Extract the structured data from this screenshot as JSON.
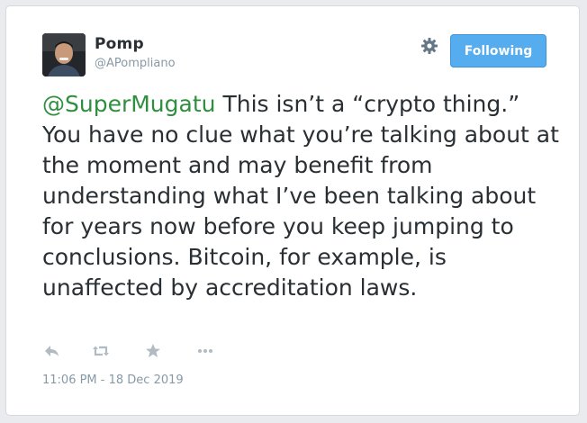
{
  "author": {
    "name": "Pomp",
    "handle": "@APompliano"
  },
  "follow_button": {
    "label": "Following"
  },
  "tweet": {
    "mention": "@SuperMugatu",
    "body": " This isn’t a “crypto thing.” You have no clue what you’re talking about at the moment and may benefit from understanding what I’ve been talking about for years now before you keep jumping to conclusions. Bitcoin, for example, is unaffected by accreditation laws."
  },
  "actions": {
    "icons": [
      "reply-icon",
      "retweet-icon",
      "like-icon",
      "more-icon"
    ]
  },
  "timestamp": "11:06 PM - 18 Dec 2019",
  "colors": {
    "accent": "#55acee",
    "mention": "#2f8f3f",
    "text": "#292f33",
    "muted": "#8899a6"
  }
}
